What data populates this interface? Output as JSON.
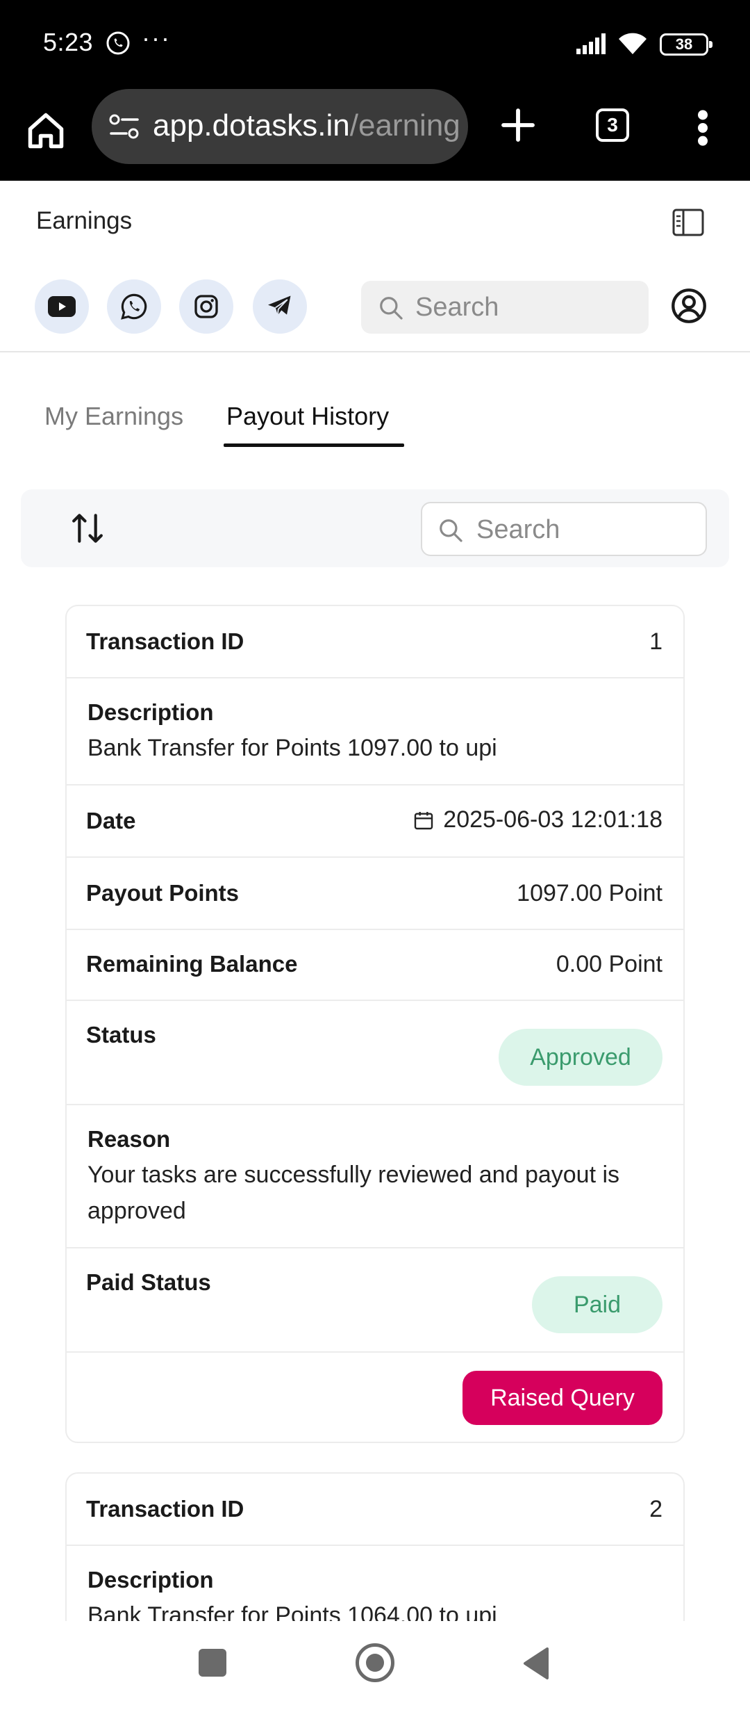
{
  "status_bar": {
    "time": "5:23",
    "overflow_dots": "···",
    "battery": "38"
  },
  "browser": {
    "url_host": "app.dotasks.in",
    "url_path": "/earning",
    "tab_count": "3"
  },
  "header": {
    "title": "Earnings",
    "search_placeholder": "Search",
    "social_icons": [
      "youtube-icon",
      "whatsapp-icon",
      "instagram-icon",
      "telegram-icon"
    ]
  },
  "tabs": [
    {
      "label": "My Earnings",
      "active": false
    },
    {
      "label": "Payout History",
      "active": true
    }
  ],
  "filter": {
    "search_placeholder": "Search"
  },
  "transactions": [
    {
      "id_label": "Transaction ID",
      "id": "1",
      "description_label": "Description",
      "description": "Bank Transfer for Points 1097.00 to upi",
      "date_label": "Date",
      "date": "2025-06-03 12:01:18",
      "payout_label": "Payout Points",
      "payout": "1097.00 Point",
      "balance_label": "Remaining Balance",
      "balance": "0.00 Point",
      "status_label": "Status",
      "status": "Approved",
      "reason_label": "Reason",
      "reason": "Your tasks are successfully reviewed and payout is approved",
      "paid_status_label": "Paid Status",
      "paid_status": "Paid",
      "query_button": "Raised Query"
    },
    {
      "id_label": "Transaction ID",
      "id": "2",
      "description_label": "Description",
      "description": "Bank Transfer for Points 1064.00 to upi"
    }
  ],
  "colors": {
    "pill_bg": "#dcf5ea",
    "pill_text": "#3a9b6d",
    "query_button": "#d6005c"
  }
}
